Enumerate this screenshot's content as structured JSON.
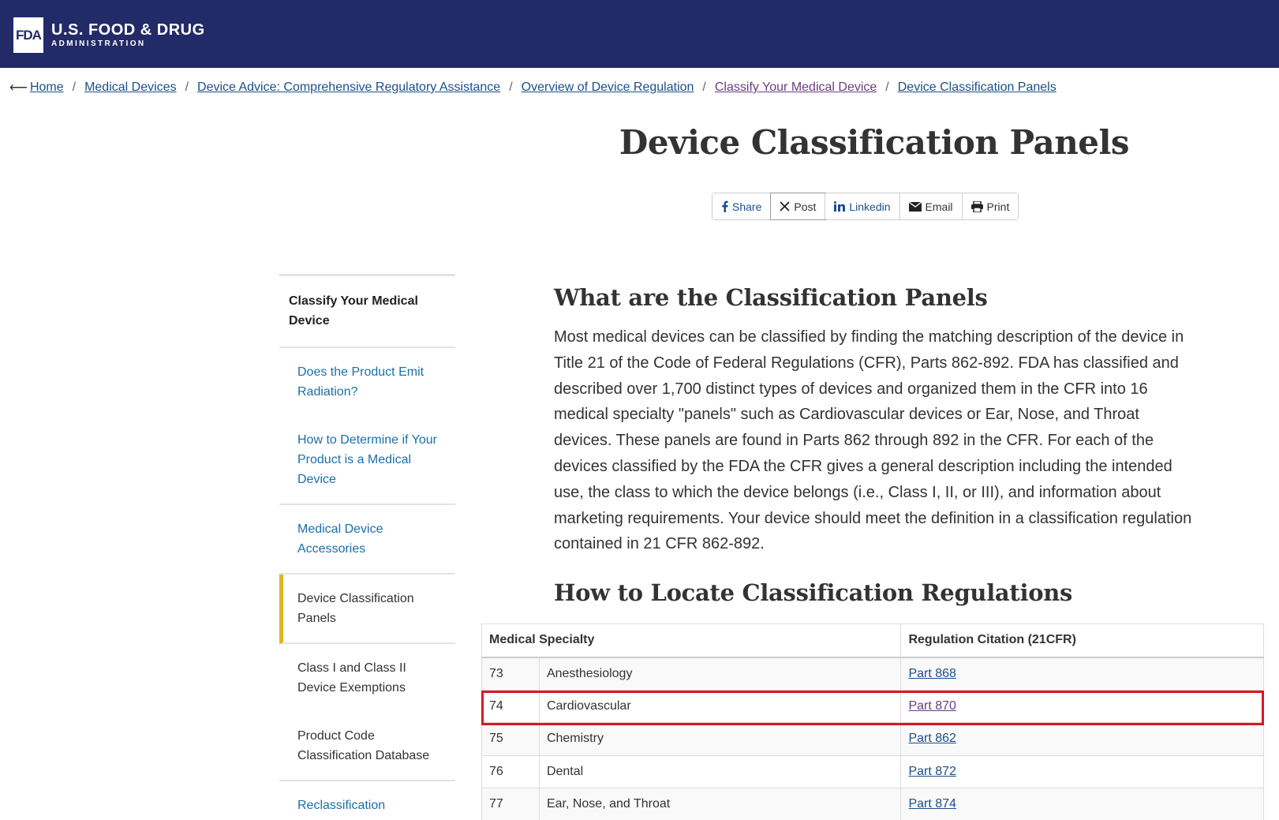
{
  "header": {
    "logo_mark": "FDA",
    "logo_line1": "U.S. FOOD & DRUG",
    "logo_line2": "ADMINISTRATION",
    "background": "#222b68"
  },
  "breadcrumb": {
    "back_icon": "⟵",
    "items": [
      "Home",
      "Medical Devices",
      "Device Advice: Comprehensive Regulatory Assistance",
      "Overview of Device Regulation",
      "Classify Your Medical Device",
      "Device Classification Panels"
    ],
    "separator": "/"
  },
  "page_title": "Device Classification Panels",
  "share": {
    "facebook": "Share",
    "x": "Post",
    "linkedin": "Linkedin",
    "email": "Email",
    "print": "Print"
  },
  "sidenav": {
    "heading": "Classify Your Medical Device",
    "items": [
      "Does the Product Emit Radiation?",
      "How to Determine if Your Product is a Medical Device",
      "Medical Device Accessories",
      "Device Classification Panels",
      "Class I and Class II Device Exemptions",
      "Product Code Classification Database",
      "Reclassification"
    ],
    "active_color": "#e7b225"
  },
  "content": {
    "section1_title": "What are the Classification Panels",
    "section1_body": "Most medical devices can be classified by finding the matching description of the device in Title 21 of the Code of Federal Regulations (CFR), Parts 862-892. FDA has classified and described over 1,700 distinct types of devices and organized them in the CFR into 16 medical specialty \"panels\" such as Cardiovascular devices or Ear, Nose, and Throat devices. These panels are found in Parts 862 through 892 in the CFR. For each of the devices classified by the FDA the CFR gives a general description including the intended use, the class to which the device belongs (i.e., Class I, II, or III), and information about marketing requirements. Your device should meet the definition in a classification regulation contained in 21 CFR 862-892.",
    "section2_title": "How to Locate Classification Regulations"
  },
  "table": {
    "headers": [
      "Medical Specialty",
      "Regulation Citation (21CFR)"
    ],
    "rows": [
      {
        "code": "73",
        "specialty": "Anesthesiology",
        "citation": "Part 868"
      },
      {
        "code": "74",
        "specialty": "Cardiovascular",
        "citation": "Part 870"
      },
      {
        "code": "75",
        "specialty": "Chemistry",
        "citation": "Part 862"
      },
      {
        "code": "76",
        "specialty": "Dental",
        "citation": "Part 872"
      },
      {
        "code": "77",
        "specialty": "Ear, Nose, and Throat",
        "citation": "Part 874"
      }
    ],
    "highlight_color": "#d71920"
  }
}
